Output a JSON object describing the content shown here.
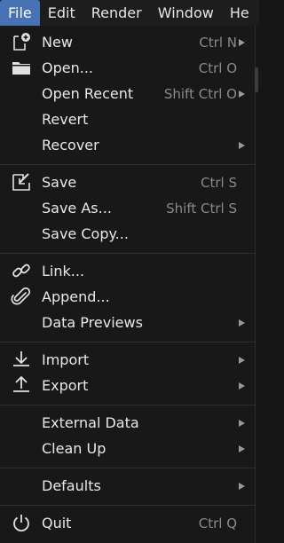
{
  "menubar": {
    "tabs": [
      "File",
      "Edit",
      "Render",
      "Window",
      "He"
    ]
  },
  "file_menu": {
    "new": {
      "label": "New",
      "shortcut": "Ctrl N"
    },
    "open": {
      "label": "Open...",
      "shortcut": "Ctrl O"
    },
    "open_recent": {
      "label": "Open Recent",
      "shortcut": "Shift Ctrl O"
    },
    "revert": {
      "label": "Revert"
    },
    "recover": {
      "label": "Recover"
    },
    "save": {
      "label": "Save",
      "shortcut": "Ctrl S"
    },
    "save_as": {
      "label": "Save As...",
      "shortcut": "Shift Ctrl S"
    },
    "save_copy": {
      "label": "Save Copy..."
    },
    "link": {
      "label": "Link..."
    },
    "append": {
      "label": "Append..."
    },
    "data_previews": {
      "label": "Data Previews"
    },
    "import": {
      "label": "Import"
    },
    "export": {
      "label": "Export"
    },
    "external_data": {
      "label": "External Data"
    },
    "clean_up": {
      "label": "Clean Up"
    },
    "defaults": {
      "label": "Defaults"
    },
    "quit": {
      "label": "Quit",
      "shortcut": "Ctrl Q"
    }
  },
  "colors": {
    "accent": "#4772b3",
    "background": "#181818",
    "text": "#e8e8e8",
    "shortcut_text": "#8a8a8a"
  },
  "icons": {
    "new": "new-file-icon",
    "open": "folder-icon",
    "save": "save-icon",
    "link": "link-icon",
    "append": "paperclip-icon",
    "import": "import-icon",
    "export": "export-icon",
    "quit": "power-icon"
  }
}
